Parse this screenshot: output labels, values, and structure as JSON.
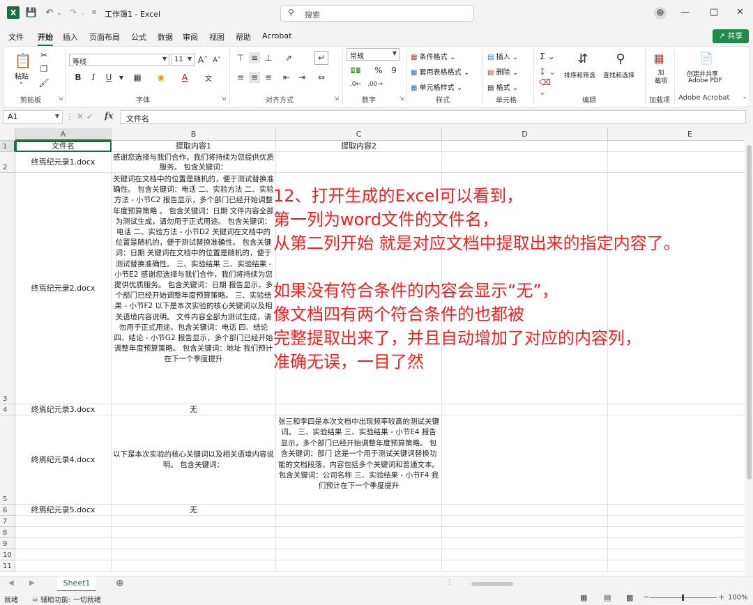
{
  "titlebar": {
    "app_icon": "excel-logo",
    "workbook_title": "工作簿1 - Excel",
    "search_placeholder": "搜索"
  },
  "menu": {
    "items": [
      "文件",
      "开始",
      "插入",
      "页面布局",
      "公式",
      "数据",
      "审阅",
      "视图",
      "帮助",
      "Acrobat"
    ],
    "active": "开始",
    "share_label": "共享"
  },
  "ribbon": {
    "paste_label": "粘贴",
    "clipboard_label": "剪贴板",
    "font_name": "等线",
    "font_size": "11",
    "font_label": "字体",
    "align_label": "对齐方式",
    "number_format": "常规",
    "number_label": "数字",
    "cond_format": "条件格式",
    "table_format": "套用表格格式",
    "cell_style": "单元格样式",
    "style_label": "样式",
    "insert": "插入",
    "delete": "删除",
    "format": "格式",
    "cells_label": "单元格",
    "sort_filter": "排序和筛选",
    "find_select": "查找和选择",
    "editing_label": "编辑",
    "addin_label": "加载项",
    "addin_btn": "加\n载项",
    "pdf_btn_1": "创建并共享",
    "pdf_btn_2": "Adobe PDF",
    "acrobat_label": "Adobe Acrobat",
    "bold": "B",
    "italic": "I",
    "underline": "U"
  },
  "formula_bar": {
    "name_box": "A1",
    "fx": "fx",
    "content": "文件名"
  },
  "columns": [
    "A",
    "B",
    "C",
    "D",
    "E"
  ],
  "rows": [
    "1",
    "2",
    "3",
    "4",
    "5",
    "6",
    "7",
    "8",
    "9",
    "10",
    "11"
  ],
  "cells": {
    "A1": "文件名",
    "B1": "提取内容1",
    "C1": "提取内容2",
    "A2": "终焉纪元录1.docx",
    "B2": "感谢您选择与我们合作，我们将持续为您提供优质服务。 包含关键词：",
    "A3": "终焉纪元录2.docx",
    "B3": "关键词在文档中的位置是随机的，便于测试替换准确性。 包含关键词：电话 二、实验方法 二、实验方法 - 小节C2 报告显示，多个部门已经开始调整年度预算策略 。 包含关键词：日期  文件内容全部为测试生成，请勿用于正式用途。 包含关键词：电话 二、实验方法 - 小节D2 关键词在文档中的位置是随机的，便于测试替换准确性。 包含关键词：日期  关键词在文档中的位置是随机的，便于测试替换准确性。 三、实验结果 三、实验结果 - 小节E2 感谢您选择与我们合作，我们将持续为您提供优质服务。 包含关键词：日期  报告显示，多个部门已经开始调整年度预算策略。 三、实验结果 - 小节F2 以下是本次实验的核心关键词以及相关语境内容说明。  文件内容全部为测试生成，请勿用于正式用途。包含关键词：电话 四、结论 四、结论 - 小节G2 报告显示，多个部门已经开始调整年度预算策略。 包含关键词：地址  我们预计在下一个季度提升",
    "A4": "终焉纪元录3.docx",
    "B4": "无",
    "A5": "终焉纪元录4.docx",
    "B5": "以下是本次实验的核心关键词以及相关语境内容说明。 包含关键词：",
    "C5": "张三和李四是本次文档中出现频率较高的测试关键词。 三、实验结果 三、实验结果 - 小节E4 报告显示，多个部门已经开始调整年度预算策略。 包含关键词：部门  这是一个用于测试关键词替换功能的文档段落，内容包括多个关键词和普通文本。 包含关键词：公司名称 三、实验结果 - 小节F4 我们预计在下一个季度提升",
    "A6": "终焉纪元录5.docx",
    "B6": "无"
  },
  "overlay_lines": [
    "12、打开生成的Excel可以看到，",
    "第一列为word文件的文件名，",
    "从第二列开始 就是对应文档中提取出来的指定内容了。",
    "",
    "如果没有符合条件的内容会显示“无”，",
    "像文档四有两个符合条件的也都被",
    "完整提取出来了，并且自动增加了对应的内容列，",
    "准确无误，一目了然"
  ],
  "overlay_color": "#ff1a1a",
  "sheets": {
    "active": "Sheet1"
  },
  "status": {
    "ready": "就绪",
    "accessibility": "辅助功能: 一切就绪",
    "zoom": "100%"
  },
  "accent_color": "#1d6f42"
}
